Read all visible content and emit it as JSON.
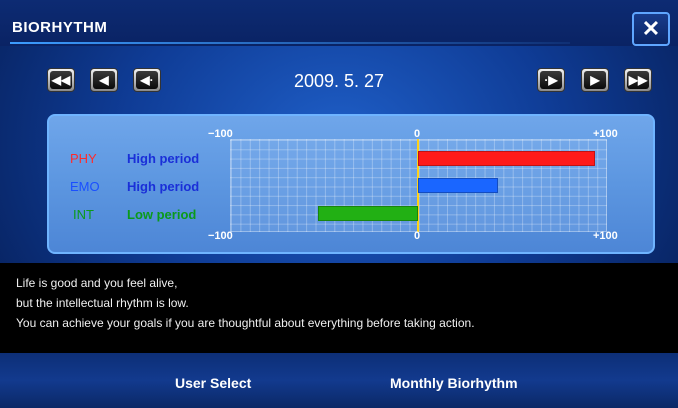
{
  "window": {
    "title": "BIORHYTHM",
    "close_label": "✕"
  },
  "nav": {
    "date": "2009. 5. 27",
    "prev_fast_icon": "⏪",
    "prev_icon": "◀",
    "prev_step_icon": "◀",
    "next_step_icon": "▶",
    "next_icon": "▶",
    "next_fast_icon": "⏩"
  },
  "chart": {
    "axis": {
      "min_label": "−100",
      "zero_label": "0",
      "max_label": "+100"
    },
    "rows": [
      {
        "code": "PHY",
        "period": "High period",
        "color": "#ff1a1a",
        "period_color": "#1a2fd8"
      },
      {
        "code": "EMO",
        "period": "High period",
        "color": "#1a66ff",
        "period_color": "#1a2fd8"
      },
      {
        "code": "INT",
        "period": "Low period",
        "color": "#22b014",
        "period_color": "#0a9a1a"
      }
    ]
  },
  "chart_data": {
    "type": "bar",
    "categories": [
      "PHY",
      "EMO",
      "INT"
    ],
    "values": [
      95,
      43,
      -54
    ],
    "ylim": [
      -100,
      100
    ]
  },
  "description": {
    "lines": [
      "Life is good and you feel alive,",
      "but the intellectual rhythm is low.",
      "You can achieve your goals if you are thoughtful about everything before taking action."
    ]
  },
  "footer": {
    "user_select": "User Select",
    "monthly": "Monthly Biorhythm"
  }
}
